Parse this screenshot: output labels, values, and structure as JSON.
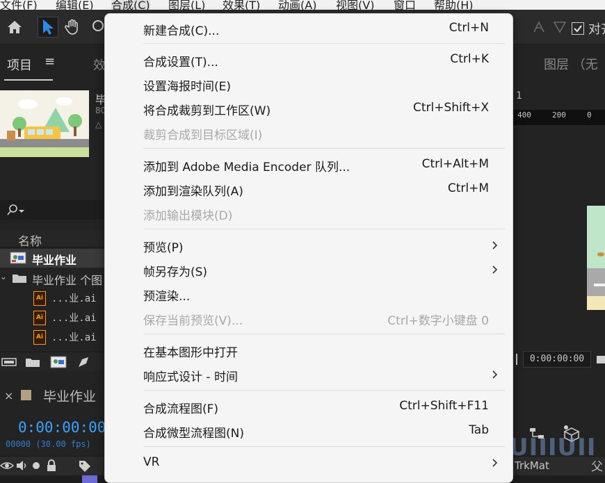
{
  "menubar": {
    "items": [
      {
        "label": "文件(F)"
      },
      {
        "label": "编辑(E)"
      },
      {
        "label": "合成(C)"
      },
      {
        "label": "图层(L)"
      },
      {
        "label": "效果(T)"
      },
      {
        "label": "动画(A)"
      },
      {
        "label": "视图(V)"
      },
      {
        "label": "窗口"
      },
      {
        "label": "帮助(H)"
      }
    ]
  },
  "toolbar": {
    "right_checkbox_label": "对齐"
  },
  "project_panel": {
    "tab_label": "项目",
    "tab_menu": "≡",
    "effects_tab_label": "效",
    "thumb_name": "毕",
    "thumb_dim": "80",
    "thumb_delta": "△",
    "column_name": "名称",
    "rows": [
      {
        "label": "毕业作业",
        "type": "comp"
      },
      {
        "label": "毕业作业 个图",
        "type": "folder"
      },
      {
        "label": "...业.ai",
        "type": "ai"
      },
      {
        "label": "...业.ai",
        "type": "ai"
      },
      {
        "label": "...业.ai",
        "type": "ai"
      }
    ],
    "ai_badge": "Ai"
  },
  "timeline": {
    "close_glyph": "×",
    "tab_label": "毕业作业",
    "timecode": "0:00:00:00",
    "frames": "00000 (30.00 fps)"
  },
  "right_panel": {
    "layer_tab_label": "图层 （无",
    "ruler_number": "1",
    "ruler_labels": [
      "400",
      "200",
      "0"
    ],
    "timecode_field": "0:00:00:00",
    "trkmat_label": "TrkMat",
    "parent_label": "父"
  },
  "watermark": {
    "text": "UIIIUII"
  },
  "menu": {
    "items": [
      {
        "label": "新建合成(C)...",
        "shortcut": "Ctrl+N",
        "enabled": true,
        "submenu": false
      },
      {
        "label": "合成设置(T)...",
        "shortcut": "Ctrl+K",
        "enabled": true,
        "submenu": false
      },
      {
        "label": "设置海报时间(E)",
        "shortcut": "",
        "enabled": true,
        "submenu": false
      },
      {
        "label": "将合成裁剪到工作区(W)",
        "shortcut": "Ctrl+Shift+X",
        "enabled": true,
        "submenu": false
      },
      {
        "label": "裁剪合成到目标区域(I)",
        "shortcut": "",
        "enabled": false,
        "submenu": false
      },
      {
        "label": "添加到 Adobe Media Encoder 队列...",
        "shortcut": "Ctrl+Alt+M",
        "enabled": true,
        "submenu": false
      },
      {
        "label": "添加到渲染队列(A)",
        "shortcut": "Ctrl+M",
        "enabled": true,
        "submenu": false
      },
      {
        "label": "添加输出模块(D)",
        "shortcut": "",
        "enabled": false,
        "submenu": false
      },
      {
        "label": "预览(P)",
        "shortcut": "",
        "enabled": true,
        "submenu": true
      },
      {
        "label": "帧另存为(S)",
        "shortcut": "",
        "enabled": true,
        "submenu": true
      },
      {
        "label": "预渲染...",
        "shortcut": "",
        "enabled": true,
        "submenu": false
      },
      {
        "label": "保存当前预览(V)...",
        "shortcut": "Ctrl+数字小键盘 0",
        "enabled": false,
        "submenu": false
      },
      {
        "label": "在基本图形中打开",
        "shortcut": "",
        "enabled": true,
        "submenu": false
      },
      {
        "label": "响应式设计 - 时间",
        "shortcut": "",
        "enabled": true,
        "submenu": true
      },
      {
        "label": "合成流程图(F)",
        "shortcut": "Ctrl+Shift+F11",
        "enabled": true,
        "submenu": false
      },
      {
        "label": "合成微型流程图(N)",
        "shortcut": "Tab",
        "enabled": true,
        "submenu": false
      },
      {
        "label": "VR",
        "shortcut": "",
        "enabled": true,
        "submenu": true
      }
    ]
  },
  "colors": {
    "accent_blue": "#3aa3ff",
    "ai_orange": "#ff9a00",
    "menu_bg": "#f5f5f5",
    "app_bg": "#232323"
  }
}
